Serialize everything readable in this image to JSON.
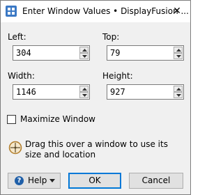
{
  "window": {
    "title": "Enter Window Values • DisplayFusion ...",
    "close_glyph": "✕",
    "app_icon": "displayfusion-icon"
  },
  "fields": {
    "left": {
      "label": "Left:",
      "value": "304"
    },
    "top": {
      "label": "Top:",
      "value": "79"
    },
    "width": {
      "label": "Width:",
      "value": "1146"
    },
    "height": {
      "label": "Height:",
      "value": "927"
    }
  },
  "maximize": {
    "label": "Maximize Window",
    "checked": false
  },
  "drag_hint": {
    "text": "Drag this over a window to use its size and location",
    "icon": "crosshair-target-icon"
  },
  "buttons": {
    "help_label": "Help",
    "help_icon": "?",
    "ok_label": "OK",
    "cancel_label": "Cancel"
  },
  "colors": {
    "accent": "#0078d7",
    "help_icon": "#1f5fa8",
    "app_icon": "#3a78c4"
  }
}
